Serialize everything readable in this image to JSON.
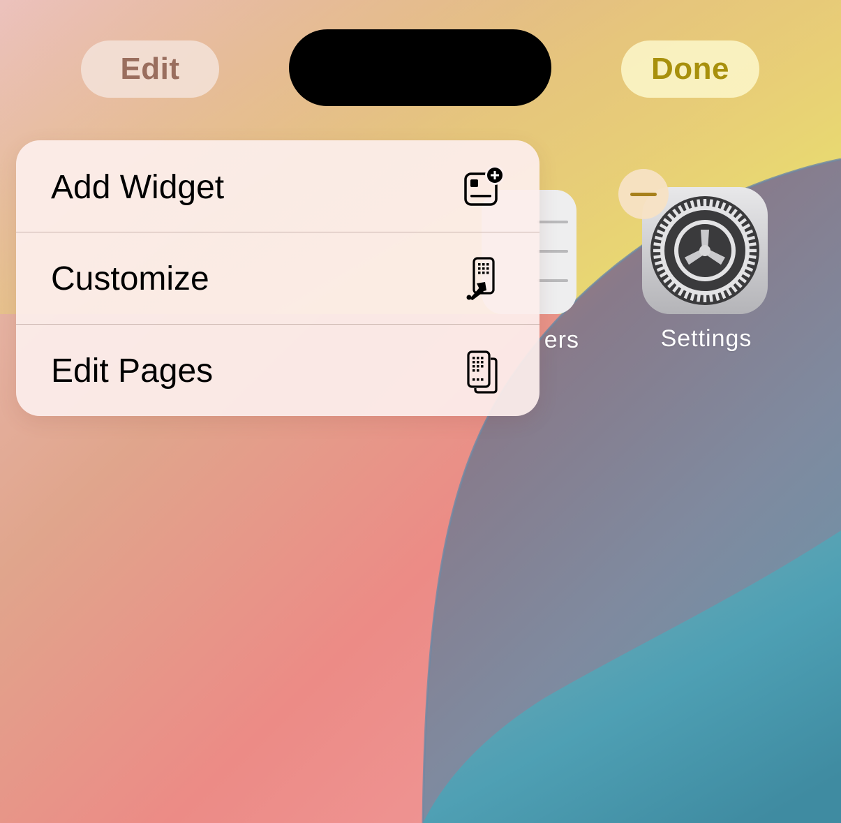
{
  "header": {
    "edit_label": "Edit",
    "done_label": "Done"
  },
  "home_apps": [
    {
      "name": "reminders",
      "label": "ers",
      "partially_hidden": true
    },
    {
      "name": "settings",
      "label": "Settings",
      "remove_badge": "minus-icon"
    }
  ],
  "context_menu": {
    "items": [
      {
        "label": "Add Widget",
        "icon": "add-widget-icon"
      },
      {
        "label": "Customize",
        "icon": "customize-icon"
      },
      {
        "label": "Edit Pages",
        "icon": "edit-pages-icon"
      }
    ]
  },
  "colors": {
    "edit_text": "#9a6e5e",
    "done_text": "#a8900c",
    "badge_minus": "#a7801b",
    "menu_background": "#fceeec"
  }
}
